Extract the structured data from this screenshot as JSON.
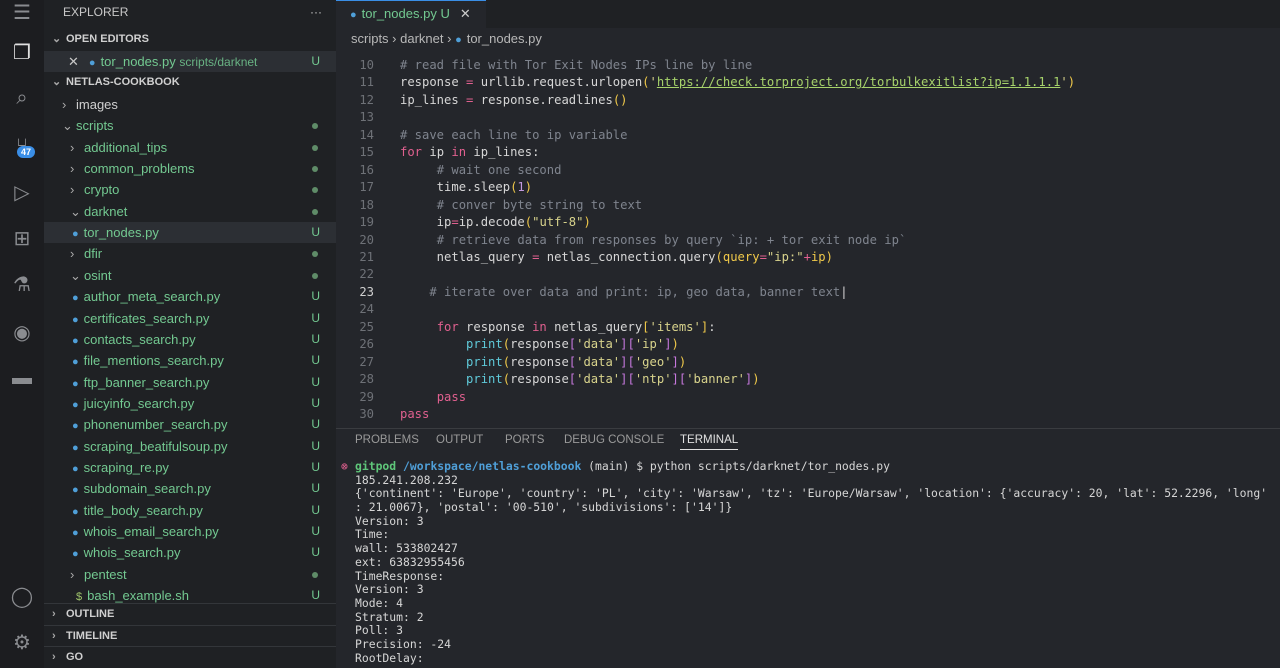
{
  "activity": {
    "icons": [
      "menu-icon",
      "files-icon",
      "search-icon",
      "source-control-icon",
      "run-debug-icon",
      "extensions-icon",
      "testing-icon",
      "github-icon",
      "docker-icon",
      "account-icon",
      "settings-icon"
    ],
    "scm_badge": "47"
  },
  "sidebar": {
    "title": "EXPLORER",
    "more": "···",
    "open_editors": "OPEN EDITORS",
    "open_file": {
      "name": "tor_nodes.py",
      "path": "scripts/darknet",
      "status": "U"
    },
    "root": "NETLAS-COOKBOOK",
    "tree": [
      {
        "label": "images",
        "type": "folder",
        "open": false,
        "depth": 0,
        "color": "normal",
        "mark": ""
      },
      {
        "label": "scripts",
        "type": "folder",
        "open": true,
        "depth": 0,
        "color": "green",
        "mark": "dot"
      },
      {
        "label": "additional_tips",
        "type": "folder",
        "open": false,
        "depth": 1,
        "color": "green",
        "mark": "dot"
      },
      {
        "label": "common_problems",
        "type": "folder",
        "open": false,
        "depth": 1,
        "color": "green",
        "mark": "dot"
      },
      {
        "label": "crypto",
        "type": "folder",
        "open": false,
        "depth": 1,
        "color": "green",
        "mark": "dot"
      },
      {
        "label": "darknet",
        "type": "folder",
        "open": true,
        "depth": 1,
        "color": "green",
        "mark": "dot"
      },
      {
        "label": "tor_nodes.py",
        "type": "py",
        "depth": 2,
        "color": "green",
        "mark": "U",
        "selected": true
      },
      {
        "label": "dfir",
        "type": "folder",
        "open": false,
        "depth": 1,
        "color": "green",
        "mark": "dot"
      },
      {
        "label": "osint",
        "type": "folder",
        "open": true,
        "depth": 1,
        "color": "green",
        "mark": "dot"
      },
      {
        "label": "author_meta_search.py",
        "type": "py",
        "depth": 2,
        "color": "green",
        "mark": "U"
      },
      {
        "label": "certificates_search.py",
        "type": "py",
        "depth": 2,
        "color": "green",
        "mark": "U"
      },
      {
        "label": "contacts_search.py",
        "type": "py",
        "depth": 2,
        "color": "green",
        "mark": "U"
      },
      {
        "label": "file_mentions_search.py",
        "type": "py",
        "depth": 2,
        "color": "green",
        "mark": "U"
      },
      {
        "label": "ftp_banner_search.py",
        "type": "py",
        "depth": 2,
        "color": "green",
        "mark": "U"
      },
      {
        "label": "juicyinfo_search.py",
        "type": "py",
        "depth": 2,
        "color": "green",
        "mark": "U"
      },
      {
        "label": "phonenumber_search.py",
        "type": "py",
        "depth": 2,
        "color": "green",
        "mark": "U"
      },
      {
        "label": "scraping_beatifulsoup.py",
        "type": "py",
        "depth": 2,
        "color": "green",
        "mark": "U"
      },
      {
        "label": "scraping_re.py",
        "type": "py",
        "depth": 2,
        "color": "green",
        "mark": "U"
      },
      {
        "label": "subdomain_search.py",
        "type": "py",
        "depth": 2,
        "color": "green",
        "mark": "U"
      },
      {
        "label": "title_body_search.py",
        "type": "py",
        "depth": 2,
        "color": "green",
        "mark": "U"
      },
      {
        "label": "whois_email_search.py",
        "type": "py",
        "depth": 2,
        "color": "green",
        "mark": "U"
      },
      {
        "label": "whois_search.py",
        "type": "py",
        "depth": 2,
        "color": "green",
        "mark": "U"
      },
      {
        "label": "pentest",
        "type": "folder",
        "open": false,
        "depth": 1,
        "color": "green",
        "mark": "dot"
      },
      {
        "label": "bash_example.sh",
        "type": "sh",
        "depth": 1,
        "color": "green",
        "mark": "U"
      }
    ],
    "sections": [
      "OUTLINE",
      "TIMELINE",
      "GO"
    ]
  },
  "tab": {
    "name": "tor_nodes.py",
    "status": "U"
  },
  "breadcrumb": [
    "scripts",
    "darknet",
    "tor_nodes.py"
  ],
  "code": [
    {
      "n": "10",
      "t": [
        [
          "c",
          "# read file with Tor Exit Nodes IPs line by line"
        ]
      ]
    },
    {
      "n": "11",
      "t": [
        [
          "",
          "response "
        ],
        [
          "o",
          "="
        ],
        [
          "",
          " urllib.request.urlopen"
        ],
        [
          "b",
          "("
        ],
        [
          "s",
          "'"
        ],
        [
          "url",
          "https://check.torproject.org/torbulkexitlist?ip=1.1.1.1"
        ],
        [
          "s",
          "'"
        ],
        [
          "b",
          ")"
        ]
      ]
    },
    {
      "n": "12",
      "t": [
        [
          "",
          "ip_lines "
        ],
        [
          "o",
          "="
        ],
        [
          "",
          " response.readlines"
        ],
        [
          "b",
          "()"
        ]
      ]
    },
    {
      "n": "13",
      "t": []
    },
    {
      "n": "14",
      "t": [
        [
          "c",
          "# save each line to ip variable"
        ]
      ]
    },
    {
      "n": "15",
      "t": [
        [
          "k",
          "for"
        ],
        [
          "",
          " ip "
        ],
        [
          "k",
          "in"
        ],
        [
          "",
          " ip_lines:"
        ]
      ]
    },
    {
      "n": "16",
      "t": [
        [
          "",
          "     "
        ],
        [
          "c",
          "# wait one second"
        ]
      ]
    },
    {
      "n": "17",
      "t": [
        [
          "",
          "     time.sleep"
        ],
        [
          "b",
          "("
        ],
        [
          "n",
          "1"
        ],
        [
          "b",
          ")"
        ]
      ]
    },
    {
      "n": "18",
      "t": [
        [
          "",
          "     "
        ],
        [
          "c",
          "# conver byte string to text"
        ]
      ]
    },
    {
      "n": "19",
      "t": [
        [
          "",
          "     ip"
        ],
        [
          "o",
          "="
        ],
        [
          "",
          "ip.decode"
        ],
        [
          "b",
          "("
        ],
        [
          "s",
          "\"utf-8\""
        ],
        [
          "b",
          ")"
        ]
      ]
    },
    {
      "n": "20",
      "t": [
        [
          "",
          "     "
        ],
        [
          "c",
          "# retrieve data from responses by query `ip: + tor exit node ip`"
        ]
      ]
    },
    {
      "n": "21",
      "t": [
        [
          "",
          "     netlas_query "
        ],
        [
          "o",
          "="
        ],
        [
          "",
          " netlas_connection.query"
        ],
        [
          "b",
          "("
        ],
        [
          "b",
          "query"
        ],
        [
          "o",
          "="
        ],
        [
          "s",
          "\"ip:\""
        ],
        [
          "o",
          "+"
        ],
        [
          "b",
          "ip"
        ],
        [
          "b",
          ")"
        ]
      ]
    },
    {
      "n": "22",
      "t": []
    },
    {
      "n": "23",
      "t": [
        [
          "",
          "    "
        ],
        [
          "c",
          "# iterate over data and print: ip, geo data, banner text"
        ],
        [
          "",
          "|"
        ]
      ],
      "cur": true
    },
    {
      "n": "24",
      "t": []
    },
    {
      "n": "25",
      "t": [
        [
          "",
          "     "
        ],
        [
          "k",
          "for"
        ],
        [
          "",
          " response "
        ],
        [
          "k",
          "in"
        ],
        [
          "",
          " netlas_query"
        ],
        [
          "b",
          "["
        ],
        [
          "s",
          "'items'"
        ],
        [
          "b",
          "]"
        ],
        [
          "",
          ":"
        ]
      ]
    },
    {
      "n": "26",
      "t": [
        [
          "",
          "         "
        ],
        [
          "f",
          "print"
        ],
        [
          "b",
          "("
        ],
        [
          "",
          "response"
        ],
        [
          "p",
          "["
        ],
        [
          "s",
          "'data'"
        ],
        [
          "p",
          "]["
        ],
        [
          "s",
          "'ip'"
        ],
        [
          "p",
          "]"
        ],
        [
          "b",
          ")"
        ]
      ]
    },
    {
      "n": "27",
      "t": [
        [
          "",
          "         "
        ],
        [
          "f",
          "print"
        ],
        [
          "b",
          "("
        ],
        [
          "",
          "response"
        ],
        [
          "p",
          "["
        ],
        [
          "s",
          "'data'"
        ],
        [
          "p",
          "]["
        ],
        [
          "s",
          "'geo'"
        ],
        [
          "p",
          "]"
        ],
        [
          "b",
          ")"
        ]
      ]
    },
    {
      "n": "28",
      "t": [
        [
          "",
          "         "
        ],
        [
          "f",
          "print"
        ],
        [
          "b",
          "("
        ],
        [
          "",
          "response"
        ],
        [
          "p",
          "["
        ],
        [
          "s",
          "'data'"
        ],
        [
          "p",
          "]["
        ],
        [
          "s",
          "'ntp'"
        ],
        [
          "p",
          "]["
        ],
        [
          "s",
          "'banner'"
        ],
        [
          "p",
          "]"
        ],
        [
          "b",
          ")"
        ]
      ]
    },
    {
      "n": "29",
      "t": [
        [
          "",
          "     "
        ],
        [
          "k",
          "pass"
        ]
      ]
    },
    {
      "n": "30",
      "t": [
        [
          "k",
          "pass"
        ]
      ]
    }
  ],
  "panel": {
    "tabs": [
      "PROBLEMS",
      "OUTPUT",
      "PORTS",
      "DEBUG CONSOLE",
      "TERMINAL"
    ],
    "active": "TERMINAL"
  },
  "terminal": {
    "prompt": {
      "user": "gitpod",
      "path": "/workspace/netlas-cookbook",
      "branch": " (main) $ ",
      "cmd": "python scripts/darknet/tor_nodes.py"
    },
    "lines": [
      "185.241.208.232",
      "{'continent': 'Europe', 'country': 'PL', 'city': 'Warsaw', 'tz': 'Europe/Warsaw', 'location': {'accuracy': 20, 'lat': 52.2296, 'long'",
      ": 21.0067}, 'postal': '00-510', 'subdivisions': ['14']}",
      "Version: 3",
      "Time:",
      "wall: 533802427",
      "ext: 63832955456",
      "TimeResponse:",
      "Version: 3",
      "Mode: 4",
      "Stratum: 2",
      "Poll: 3",
      "Precision: -24",
      "RootDelay:"
    ]
  },
  "colors": {
    "accent": "#3a8ee6",
    "untracked": "#73c991"
  }
}
